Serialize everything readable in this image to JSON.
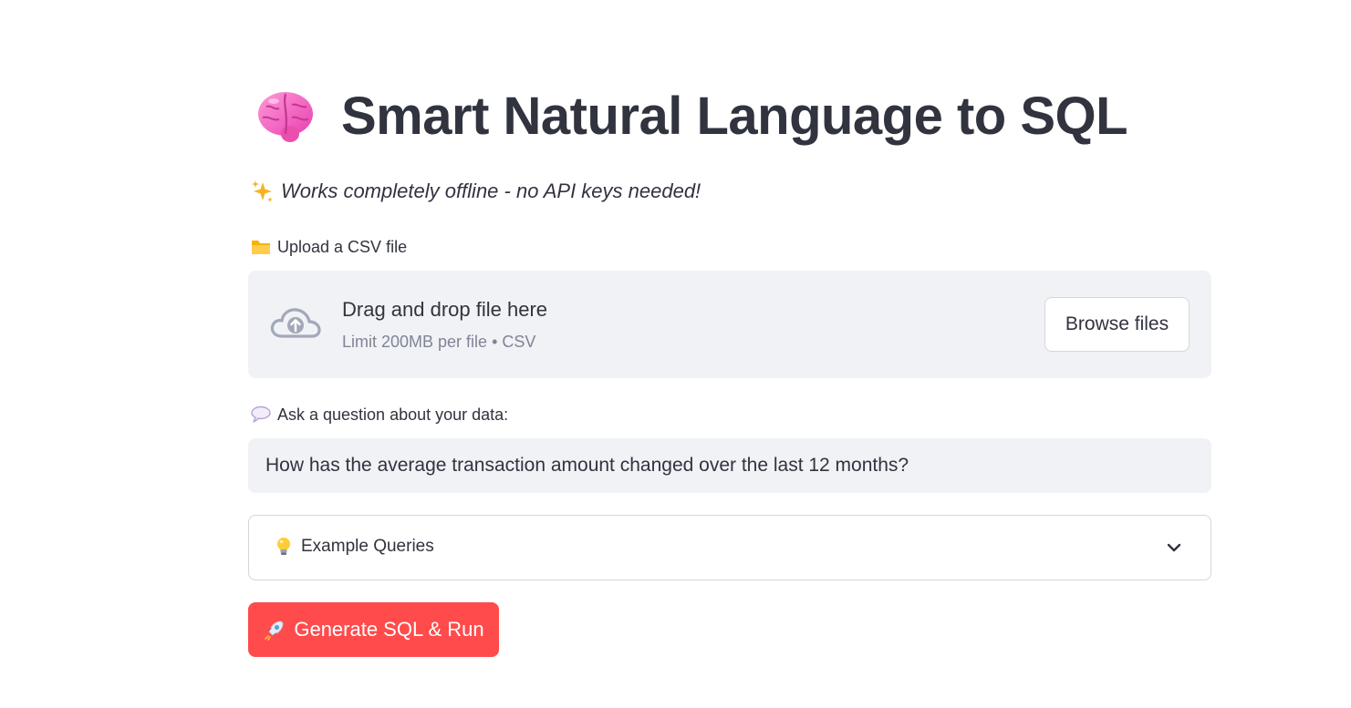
{
  "header": {
    "title": "Smart Natural Language to SQL",
    "title_icon": "brain-icon",
    "subtitle": "Works completely offline - no API keys needed!",
    "subtitle_icon": "sparkle-icon"
  },
  "upload": {
    "label": "Upload a CSV file",
    "label_icon": "folder-icon",
    "dropzone_title": "Drag and drop file here",
    "dropzone_limit": "Limit 200MB per file • CSV",
    "browse_label": "Browse files",
    "icon": "cloud-upload-icon"
  },
  "question": {
    "label": "Ask a question about your data:",
    "label_icon": "speech-bubble-icon",
    "value": "How has the average transaction amount changed over the last 12 months?"
  },
  "examples": {
    "label": "Example Queries",
    "icon": "lightbulb-icon",
    "state": "collapsed"
  },
  "run_button": {
    "label": "Generate SQL & Run",
    "icon": "rocket-icon"
  },
  "colors": {
    "accent": "#ff4b4b",
    "text": "#31333f",
    "muted": "#808495",
    "input_bg": "#f0f2f6",
    "border": "#d6d6d9"
  }
}
